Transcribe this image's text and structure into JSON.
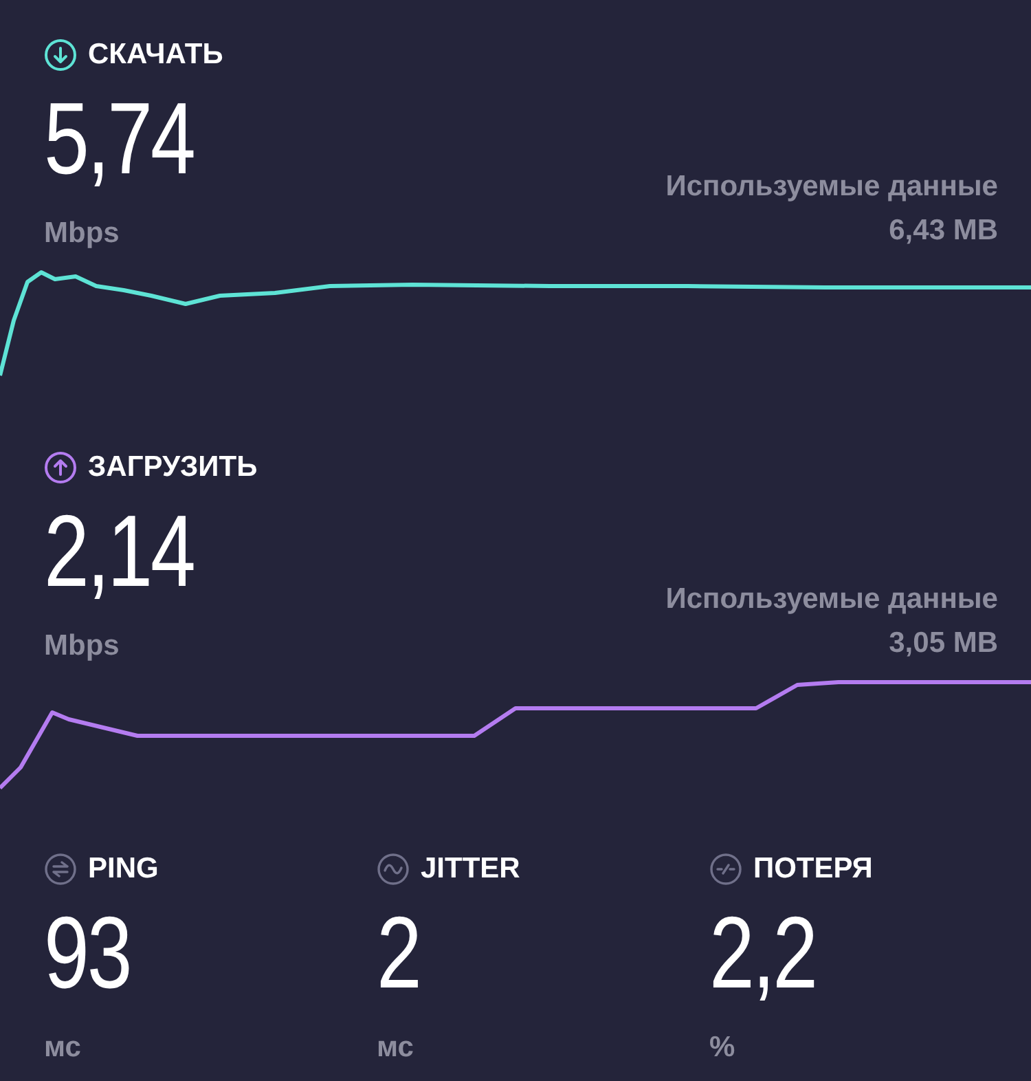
{
  "tests": [
    {
      "kind": "download",
      "label": "СКАЧАТЬ",
      "value": "5,74",
      "unit": "Mbps",
      "data_label": "Используемые данные",
      "data_value": "6,43 MB"
    },
    {
      "kind": "upload",
      "label": "ЗАГРУЗИТЬ",
      "value": "2,14",
      "unit": "Mbps",
      "data_label": "Используемые данные",
      "data_value": "3,05 MB"
    }
  ],
  "metrics": [
    {
      "kind": "ping",
      "label": "PING",
      "value": "93",
      "unit": "мс"
    },
    {
      "kind": "jitter",
      "label": "JITTER",
      "value": "2",
      "unit": "мс"
    },
    {
      "kind": "loss",
      "label": "ПОТЕРЯ",
      "value": "2,2",
      "unit": "%"
    }
  ]
}
